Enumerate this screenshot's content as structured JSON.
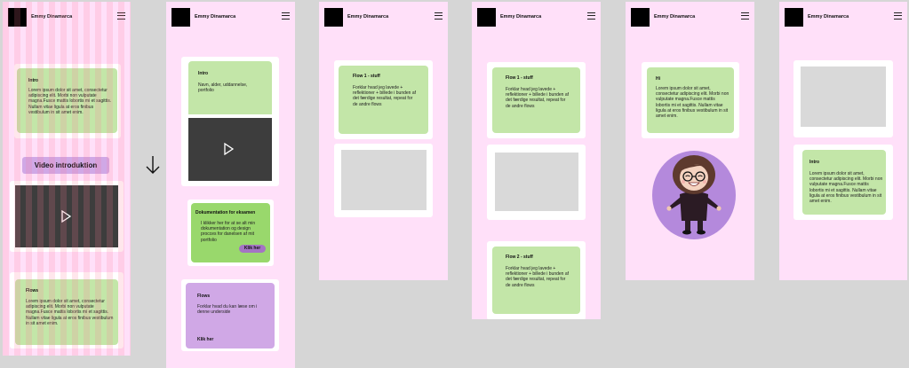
{
  "header": {
    "name": "Emmy Dinamarca"
  },
  "frame1": {
    "intro_title": "Intro",
    "intro_body": "Lorem ipsum dolor sit amet, consectetur adipiscing elit. Morbi non vulputate magna.Fusce mattis lobortis mi et sagittis. Nullam vitae ligula at eros finibus vestibulum in sit amet enim.",
    "video_label": "Video introduktion",
    "flows_title": "Flows",
    "flows_body": "Lorem ipsum dolor sit amet, consectetur adipiscing elit. Morbi non vulputate magna.Fusce mattis lobortis mi et sagittis. Nullam vitae ligula at eros finibus vestibulum in sit amet enim."
  },
  "arrow": "↓",
  "frame2": {
    "intro_title": "Intro",
    "intro_body": "Navn, alder, uddannelse, portfolio",
    "doc_title": "Dokumentation for eksamen",
    "doc_body": "I klikker her for at se alt min dokumentation og design procces for danelsen af mit portfolio",
    "doc_button": "Klik her",
    "flows_title": "Flows",
    "flows_body": "Forklar hvad du kan læse om i denne underside",
    "flows_link": "Klik her"
  },
  "frame3": {
    "flow1_title": "Flow 1 - stuff",
    "flow1_body": "Forklar hvad jeg lavede + reflektioner + billede i bunden af det færdige resultat, repeat for de andre flows"
  },
  "frame4": {
    "flow1_title": "Flow 1 - stuff",
    "flow1_body": "Forklar hvad jeg lavede + reflektioner + billede i bunden af det færdige resultat, repeat for de andre flows",
    "flow2_title": "Flow 2 - stuff",
    "flow2_body": "Forklar hvad jeg lavede + reflektioner + billede i bunden af det færdige resultat, repeat for de andre flows"
  },
  "frame5": {
    "hi_title": "Hi",
    "hi_body": "Lorem ipsum dolor sit amet, consectetur adipiscing elit. Morbi non vulputate magna.Fusce mattis lobortis mi et sagittis. Nullam vitae ligula at eros finibus vestibulum in sit amet enim."
  },
  "frame6": {
    "intro_title": "Intro",
    "intro_body": "Lorem ipsum dolor sit amet, consectetur adipiscing elit. Morbi non vulputate magna.Fusce mattis lobortis mi et sagittis. Nullam vitae ligula at eros finibus vestibulum in sit amet enim."
  },
  "icons": {
    "menu": "hamburger-icon",
    "play": "play-icon",
    "arrow": "arrow-down-icon",
    "avatar": "cartoon-avatar"
  },
  "colors": {
    "frame_bg": "#ffe0f9",
    "green": "#c3e6a8",
    "purple": "#d0a8e6",
    "video": "#3d3d3d",
    "placeholder": "#d9d9d9"
  }
}
